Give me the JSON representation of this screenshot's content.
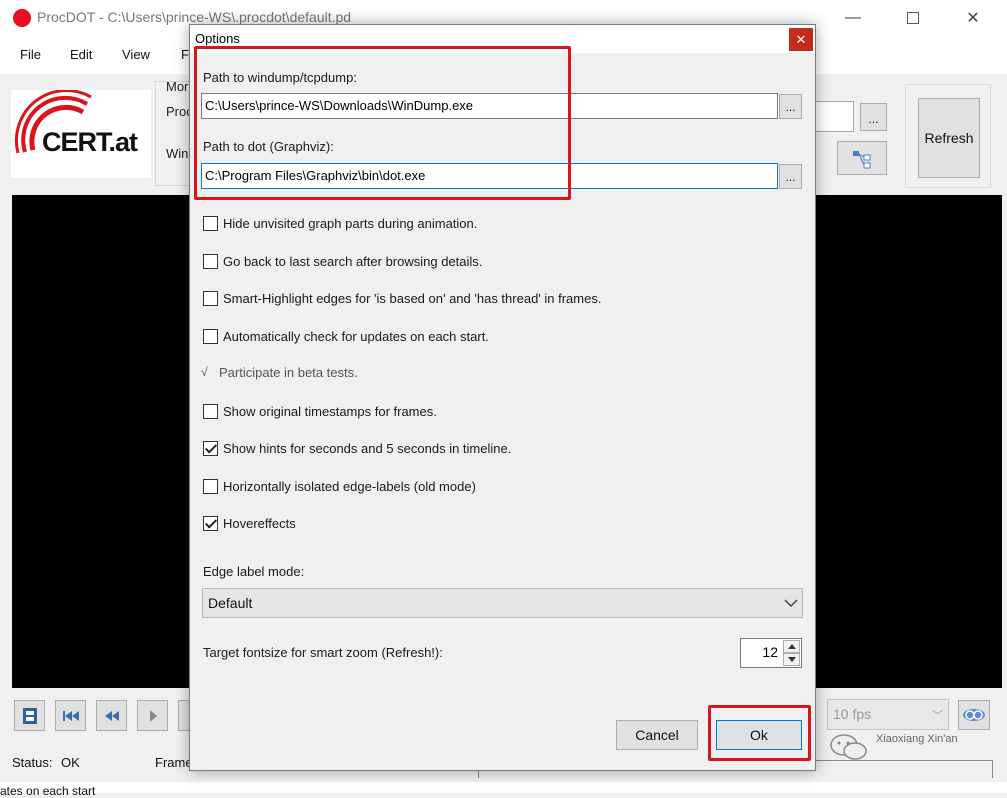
{
  "main_window": {
    "title": "ProcDOT - C:\\Users\\prince-WS\\.procdot\\default.pd",
    "menu": [
      "File",
      "Edit",
      "View",
      "F"
    ],
    "logo_text": "CERT.at",
    "partial_labels": [
      "Mor",
      "Proc",
      "Win"
    ],
    "browse_label": "...",
    "refresh_label": "Refresh",
    "fps_value": "10 fps",
    "status_label": "Status:",
    "status_value": "OK",
    "frame_label": "Frame",
    "truncated_text": "ates on each start",
    "watermark": "Xiaoxiang Xin'an"
  },
  "dialog": {
    "title": "Options",
    "close_label": "✕",
    "windump_label": "Path to windump/tcpdump:",
    "windump_value": "C:\\Users\\prince-WS\\Downloads\\WinDump.exe",
    "dot_label": "Path to dot (Graphviz):",
    "dot_value": "C:\\Program Files\\Graphviz\\bin\\dot.exe",
    "browse_label": "...",
    "checkboxes": [
      {
        "label": "Hide unvisited graph parts during animation.",
        "checked": false
      },
      {
        "label": "Go back to last search after browsing details.",
        "checked": false
      },
      {
        "label": "Smart-Highlight edges for 'is based on' and 'has thread' in frames.",
        "checked": false
      },
      {
        "label": "Automatically check for updates on each start.",
        "checked": false
      },
      {
        "label": "Show original timestamps for frames.",
        "checked": false
      },
      {
        "label": "Show hints for seconds and 5 seconds in timeline.",
        "checked": true
      },
      {
        "label": "Horizontally isolated edge-labels (old mode)",
        "checked": false
      },
      {
        "label": "Hovereffects",
        "checked": true
      }
    ],
    "beta_mark": "√",
    "beta_label": "Participate in beta tests.",
    "edge_mode_label": "Edge label mode:",
    "edge_mode_value": "Default",
    "fontsize_label": "Target fontsize for smart zoom (Refresh!):",
    "fontsize_value": "12",
    "cancel_label": "Cancel",
    "ok_label": "Ok"
  },
  "colors": {
    "annotation": "#d9141b",
    "focus": "#0078d7",
    "close": "#c42b1c"
  }
}
